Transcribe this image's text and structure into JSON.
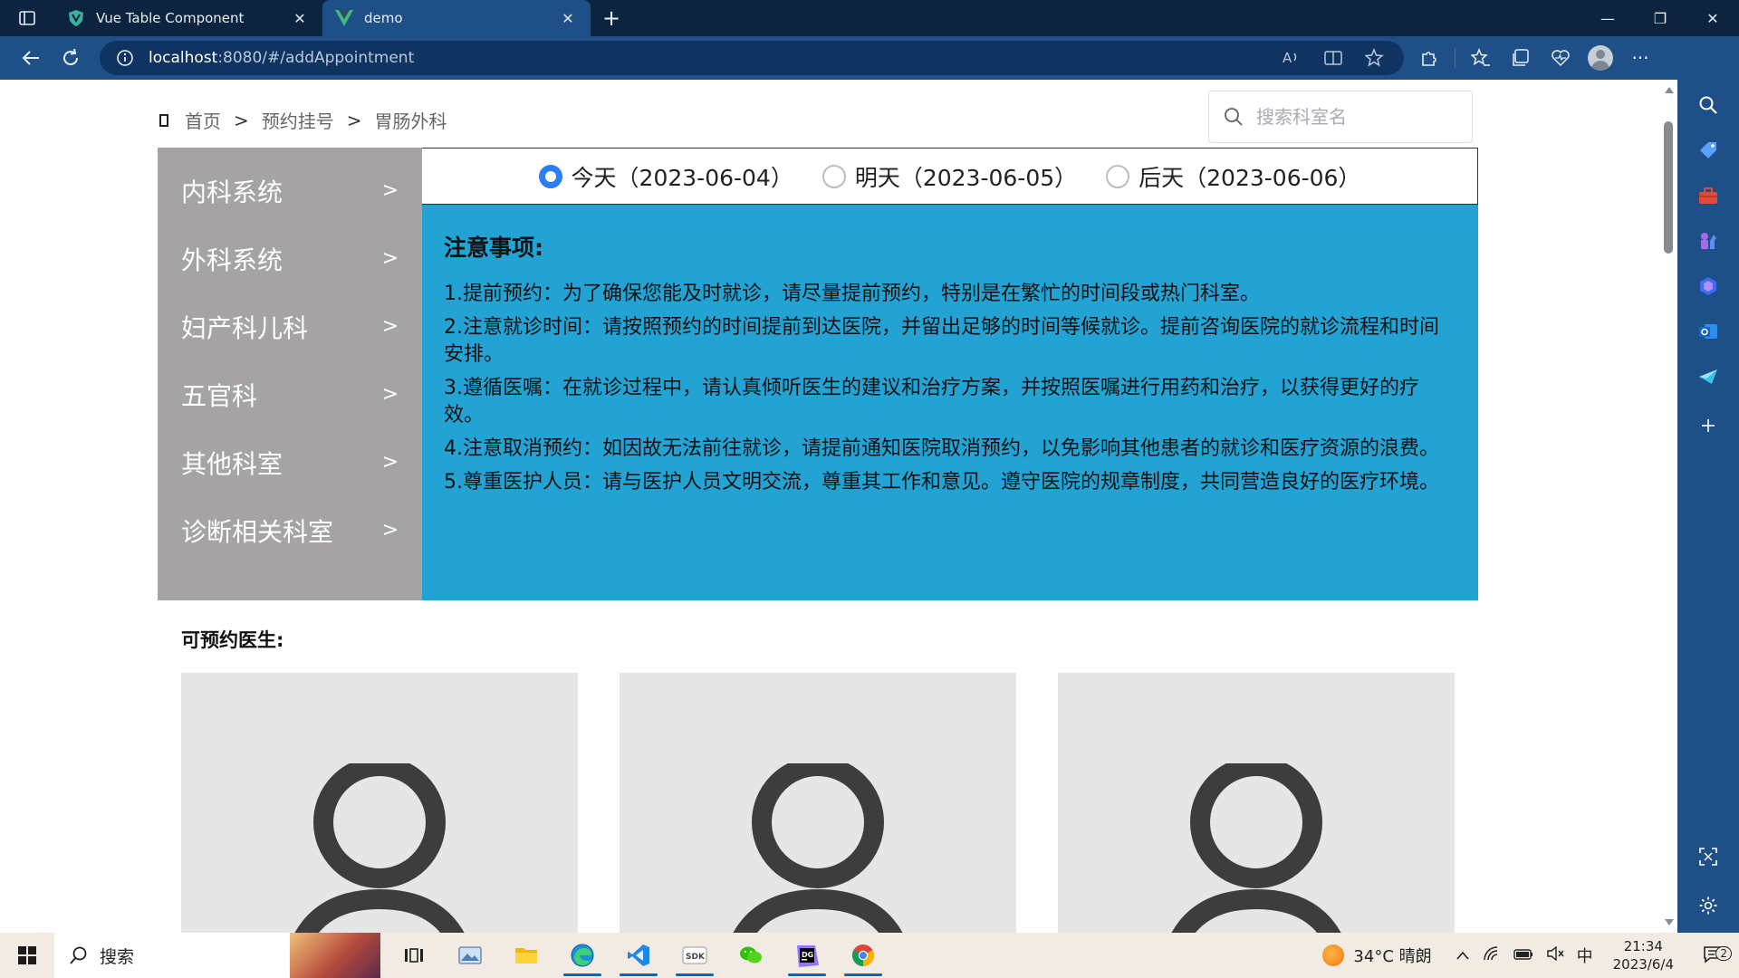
{
  "browser": {
    "tabs": [
      {
        "title": "Vue Table Component",
        "active": false
      },
      {
        "title": "demo",
        "active": true
      }
    ],
    "url_host": "localhost",
    "url_path": ":8080/#/addAppointment"
  },
  "page": {
    "breadcrumb": [
      "首页",
      "预约挂号",
      "胃肠外科"
    ],
    "breadcrumb_sep": ">",
    "search_placeholder": "搜索科室名",
    "departments": [
      {
        "label": "内科系统",
        "chev": ">"
      },
      {
        "label": "外科系统",
        "chev": ">"
      },
      {
        "label": "妇产科儿科",
        "chev": ">"
      },
      {
        "label": "五官科",
        "chev": ">"
      },
      {
        "label": "其他科室",
        "chev": ">"
      },
      {
        "label": "诊断相关科室",
        "chev": ">"
      }
    ],
    "dates": [
      {
        "label": "今天（2023-06-04）",
        "checked": true
      },
      {
        "label": "明天（2023-06-05）",
        "checked": false
      },
      {
        "label": "后天（2023-06-06）",
        "checked": false
      }
    ],
    "notice_title": "注意事项:",
    "notices": [
      "1.提前预约：为了确保您能及时就诊，请尽量提前预约，特别是在繁忙的时间段或热门科室。",
      "2.注意就诊时间：请按照预约的时间提前到达医院，并留出足够的时间等候就诊。提前咨询医院的就诊流程和时间安排。",
      "3.遵循医嘱：在就诊过程中，请认真倾听医生的建议和治疗方案，并按照医嘱进行用药和治疗，以获得更好的疗效。",
      "4.注意取消预约：如因故无法前往就诊，请提前通知医院取消预约，以免影响其他患者的就诊和医疗资源的浪费。",
      "5.尊重医护人员：请与医护人员文明交流，尊重其工作和意见。遵守医院的规章制度，共同营造良好的医疗环境。"
    ],
    "doctors_heading": "可预约医生:",
    "doctor_count": 3
  },
  "taskbar": {
    "search_label": "搜索",
    "weather": "34°C  晴朗",
    "ime": "中",
    "time": "21:34",
    "date": "2023/6/4",
    "notif_count": "2"
  },
  "colors": {
    "sidebar_bg": "#a5a3a3",
    "notice_bg": "#23a3d3",
    "radio_checked": "#2e7cf6",
    "browser_frame": "#1e4f86"
  }
}
